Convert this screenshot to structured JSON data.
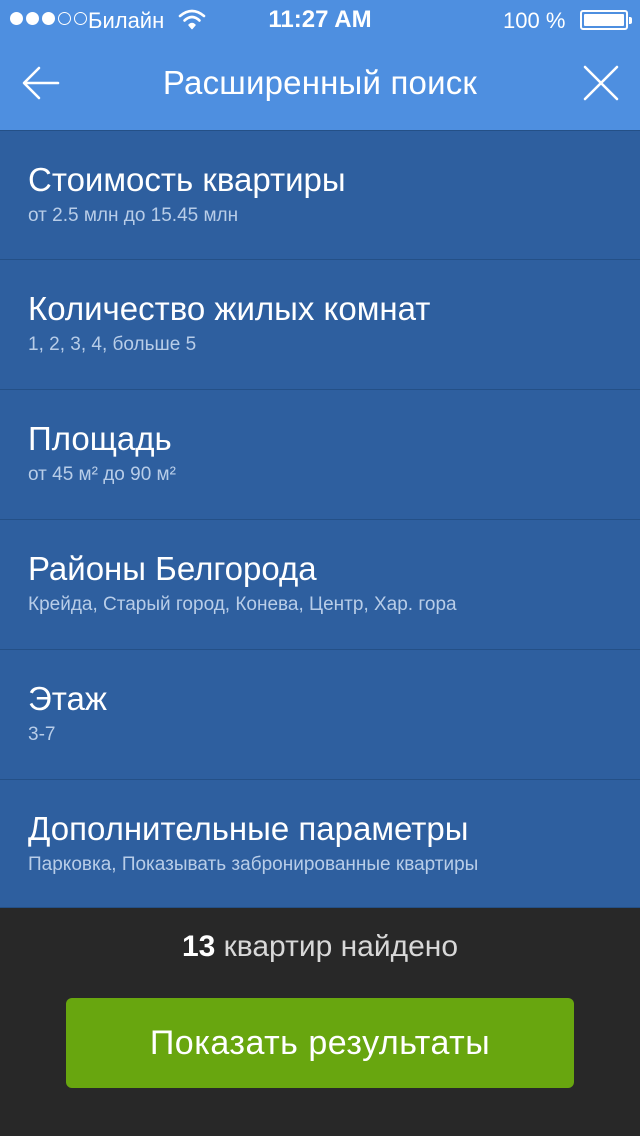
{
  "status_bar": {
    "signal_dots": 5,
    "signal_filled": 3,
    "carrier": "Билайн",
    "time": "11:27 AM",
    "battery_label": "100 %",
    "battery_level": 1.0
  },
  "nav": {
    "title": "Расширенный поиск",
    "back_icon": "arrow-left-icon",
    "close_icon": "close-icon"
  },
  "filters": [
    {
      "title": "Стоимость квартиры",
      "subtitle": "от 2.5 млн до 15.45 млн"
    },
    {
      "title": "Количество жилых комнат",
      "subtitle": "1, 2, 3, 4, больше 5"
    },
    {
      "title": "Площадь",
      "subtitle": "от 45 м² до 90 м²"
    },
    {
      "title": "Районы Белгорода",
      "subtitle": "Крейда, Старый город, Конева, Центр, Хар. гора"
    },
    {
      "title": "Этаж",
      "subtitle": "3-7"
    },
    {
      "title": "Дополнительные параметры",
      "subtitle": "Парковка, Показывать забронированные квартиры"
    }
  ],
  "results": {
    "count": "13",
    "label": " квартир найдено",
    "button_label": "Показать результаты"
  },
  "colors": {
    "header": "#4e8fe0",
    "list_bg": "#2e5f9f",
    "footer": "#282828",
    "button": "#68a60f"
  }
}
